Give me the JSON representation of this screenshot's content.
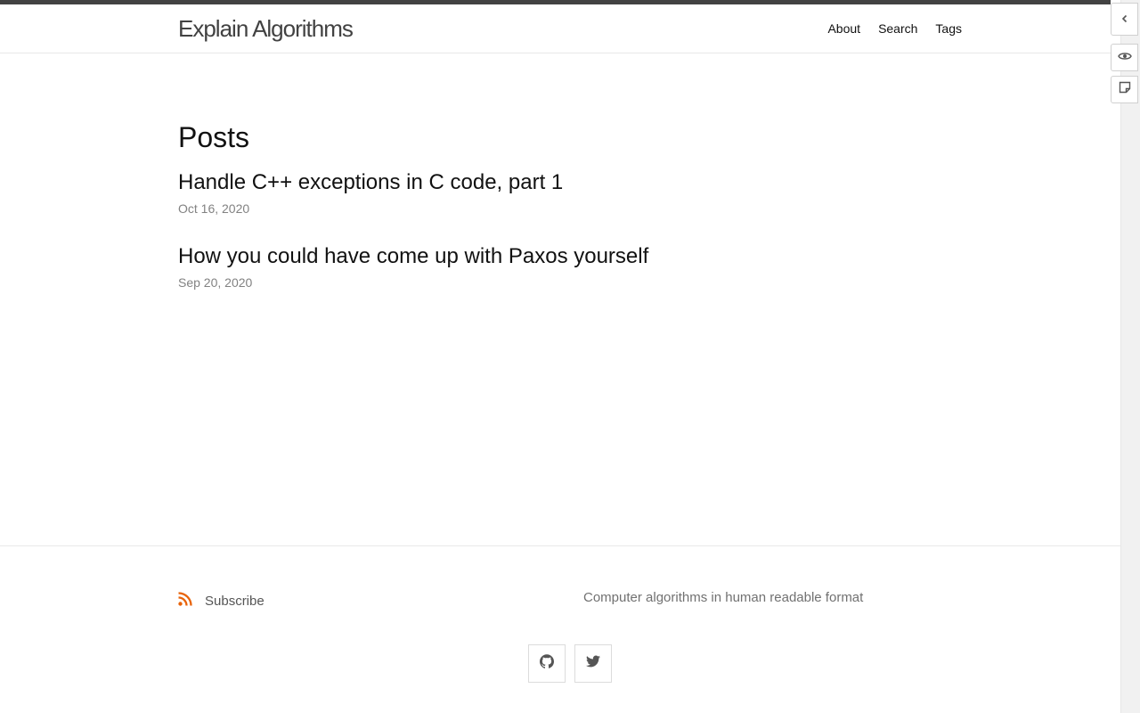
{
  "header": {
    "site_title": "Explain Algorithms",
    "nav": [
      {
        "label": "About"
      },
      {
        "label": "Search"
      },
      {
        "label": "Tags"
      }
    ]
  },
  "main": {
    "heading": "Posts",
    "posts": [
      {
        "title": "Handle C++ exceptions in C code, part 1",
        "date": "Oct 16, 2020"
      },
      {
        "title": "How you could have come up with Paxos yourself",
        "date": "Sep 20, 2020"
      }
    ]
  },
  "footer": {
    "subscribe_label": "Subscribe",
    "description": "Computer algorithms in human readable format",
    "social_icons": [
      "github-icon",
      "twitter-icon"
    ]
  },
  "side_panel": {
    "icons": [
      "chevron-left-icon",
      "eye-icon",
      "sticky-note-icon"
    ]
  },
  "colors": {
    "rss_orange": "#e8630a",
    "title_gray": "#424242",
    "meta_gray": "#828282"
  }
}
